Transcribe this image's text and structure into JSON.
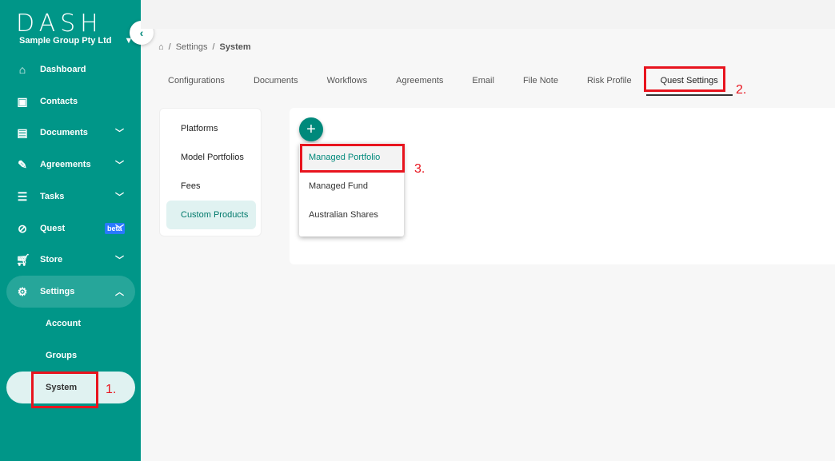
{
  "sidebar": {
    "logo": "DASH",
    "org": "Sample Group Pty Ltd",
    "items": [
      {
        "label": "Dashboard",
        "icon": "home-icon"
      },
      {
        "label": "Contacts",
        "icon": "contact-icon"
      },
      {
        "label": "Documents",
        "icon": "documents-icon"
      },
      {
        "label": "Agreements",
        "icon": "pen-icon"
      },
      {
        "label": "Tasks",
        "icon": "tasks-icon"
      },
      {
        "label": "Quest",
        "icon": "compass-icon",
        "badge": "beta"
      },
      {
        "label": "Store",
        "icon": "cart-icon"
      },
      {
        "label": "Settings",
        "icon": "gear-icon"
      }
    ],
    "sub_items": [
      {
        "label": "Account"
      },
      {
        "label": "Groups"
      },
      {
        "label": "System"
      }
    ]
  },
  "breadcrumb": {
    "current": "System",
    "parent": "Settings"
  },
  "tabs": [
    {
      "label": "Configurations"
    },
    {
      "label": "Documents"
    },
    {
      "label": "Workflows"
    },
    {
      "label": "Agreements"
    },
    {
      "label": "Email"
    },
    {
      "label": "File Note"
    },
    {
      "label": "Risk Profile"
    },
    {
      "label": "Quest Settings",
      "active": true
    }
  ],
  "left_menu": [
    {
      "label": "Platforms"
    },
    {
      "label": "Model Portfolios"
    },
    {
      "label": "Fees"
    },
    {
      "label": "Custom Products",
      "selected": true
    }
  ],
  "add_menu": [
    {
      "label": "Managed Portfolio"
    },
    {
      "label": "Managed Fund"
    },
    {
      "label": "Australian Shares"
    }
  ],
  "annotations": {
    "step1": "1.",
    "step2": "2.",
    "step3": "3."
  },
  "colors": {
    "brand": "#009688",
    "annotation": "#e8141e",
    "beta": "#2979ff"
  }
}
